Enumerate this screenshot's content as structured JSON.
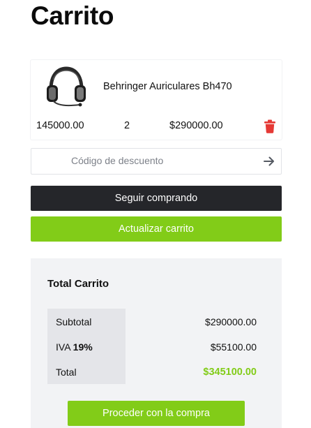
{
  "page": {
    "title": "Carrito"
  },
  "cart": {
    "items": [
      {
        "name": "Behringer Auriculares Bh470",
        "price": "145000.00",
        "quantity": "2",
        "subtotal": "$290000.00"
      }
    ]
  },
  "coupon": {
    "placeholder": "Código de descuento"
  },
  "actions": {
    "continue_label": "Seguir comprando",
    "update_label": "Actualizar carrito"
  },
  "totals": {
    "title": "Total Carrito",
    "subtotal_label": "Subtotal",
    "subtotal_value": "$290000.00",
    "iva_label": "IVA",
    "iva_percent": "19%",
    "iva_value": "$55100.00",
    "total_label": "Total",
    "total_value": "$345100.00",
    "checkout_label": "Proceder con la compra"
  },
  "icons": {
    "delete": "trash-icon",
    "apply_coupon": "arrow-right-icon",
    "product": "headphones-image"
  },
  "colors": {
    "accent_green": "#82cc18",
    "dark_button": "#25262a",
    "delete_red": "#e53935",
    "panel": "#f2f3f5"
  }
}
